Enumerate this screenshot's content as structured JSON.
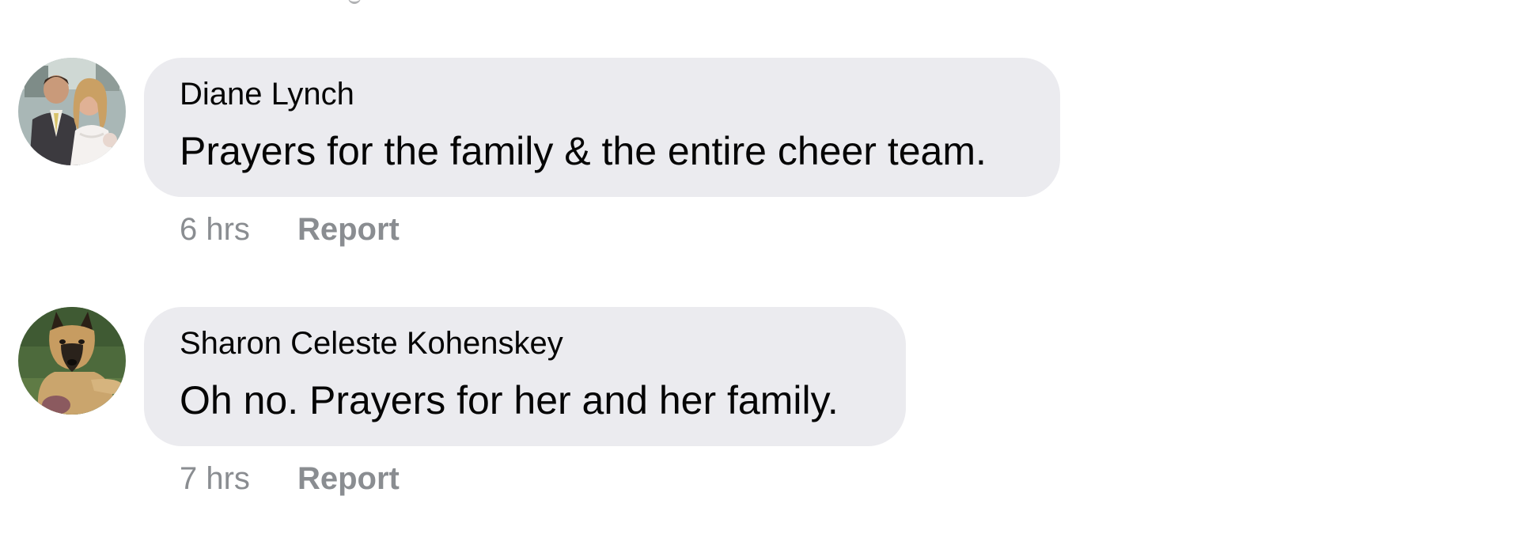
{
  "comments": [
    {
      "author": "Diane Lynch",
      "text": "Prayers for the family & the entire cheer team.",
      "time": "6 hrs",
      "action_label": "Report",
      "avatar": "couple-wedding-photo"
    },
    {
      "author": "Sharon Celeste Kohenskey",
      "text": "Oh no. Prayers for her and her family.",
      "time": "7 hrs",
      "action_label": "Report",
      "avatar": "german-shepherd-dog-photo"
    }
  ],
  "colors": {
    "bubble_bg": "#ebebef",
    "meta_text": "#8a8d91",
    "primary_text": "#050505"
  }
}
